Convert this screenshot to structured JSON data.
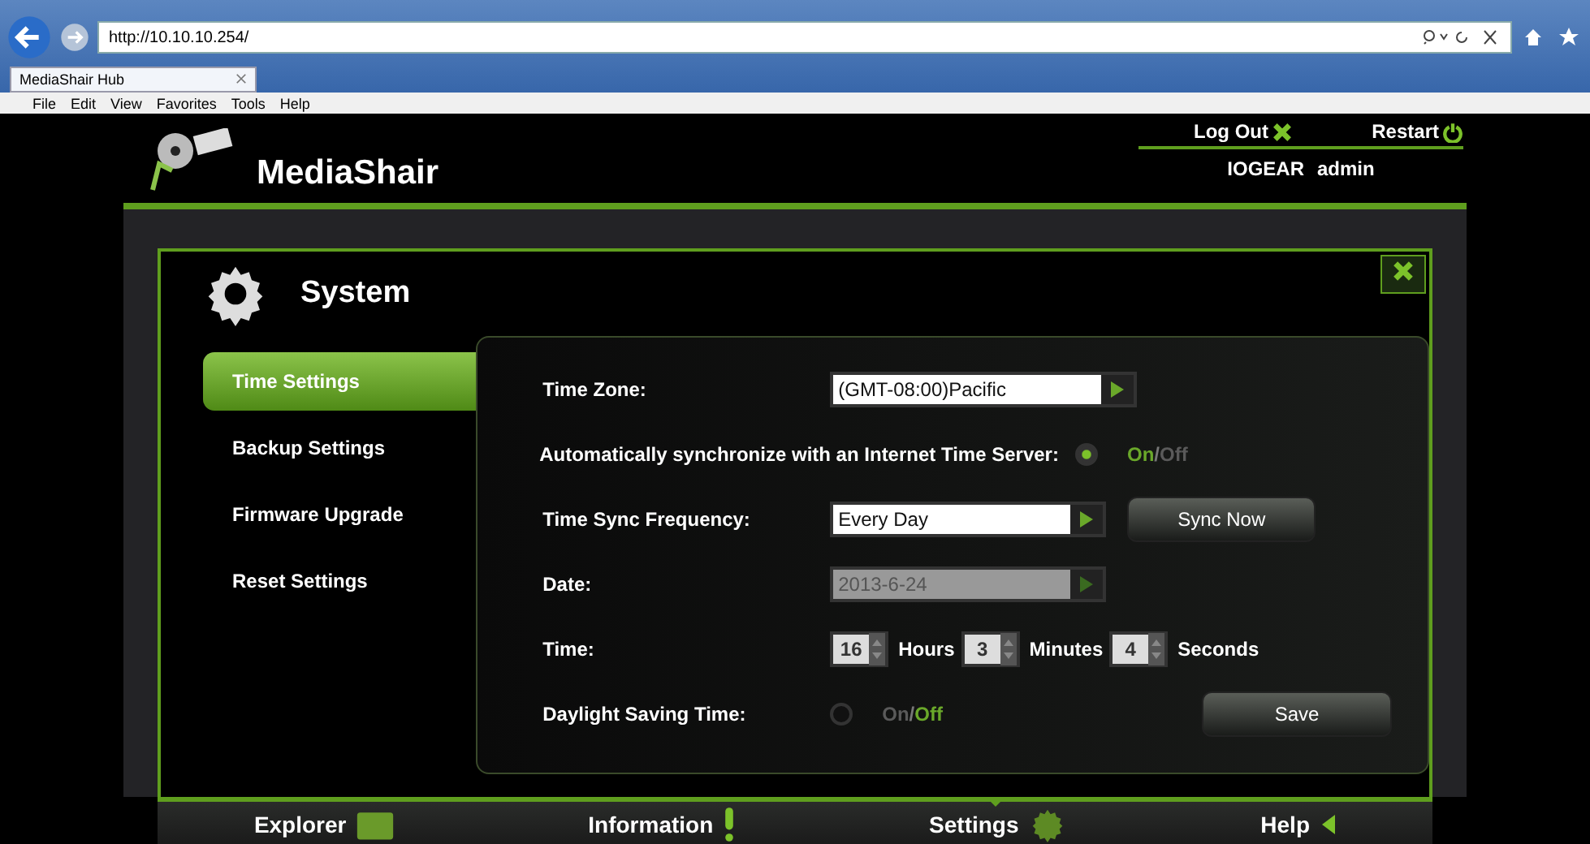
{
  "browser": {
    "url": "http://10.10.10.254/",
    "tab_title": "MediaShair Hub",
    "menu": [
      "File",
      "Edit",
      "View",
      "Favorites",
      "Tools",
      "Help"
    ]
  },
  "header": {
    "logo": "MediaShair",
    "logout": "Log Out",
    "restart": "Restart",
    "org": "IOGEAR",
    "user": "admin"
  },
  "dialog": {
    "title": "System",
    "sidebar": [
      {
        "label": "Time Settings",
        "selected": true
      },
      {
        "label": "Backup Settings",
        "selected": false
      },
      {
        "label": "Firmware Upgrade",
        "selected": false
      },
      {
        "label": "Reset Settings",
        "selected": false
      }
    ],
    "time_zone": {
      "label": "Time Zone:",
      "value": "(GMT-08:00)Pacific"
    },
    "auto_sync": {
      "label": "Automatically synchronize with an Internet Time Server:",
      "on": true,
      "on_label": "On",
      "separator": "/",
      "off_label": "Off"
    },
    "frequency": {
      "label": "Time Sync Frequency:",
      "value": "Every Day",
      "button": "Sync Now"
    },
    "date": {
      "label": "Date:",
      "value": "2013-6-24",
      "disabled": true
    },
    "time": {
      "label": "Time:",
      "parts": [
        {
          "value": "16",
          "unit": "Hours"
        },
        {
          "value": "3",
          "unit": "Minutes"
        },
        {
          "value": "4",
          "unit": "Seconds"
        }
      ]
    },
    "dst": {
      "label": "Daylight Saving Time:",
      "on": false,
      "on_label": "On",
      "separator": "/",
      "off_label": "Off"
    },
    "save": "Save"
  },
  "nav": [
    {
      "label": "Explorer",
      "kind": "folder",
      "selected": false
    },
    {
      "label": "Information",
      "kind": "info",
      "selected": false
    },
    {
      "label": "Settings",
      "kind": "gear",
      "selected": true
    },
    {
      "label": "Help",
      "kind": "help",
      "selected": false
    }
  ]
}
